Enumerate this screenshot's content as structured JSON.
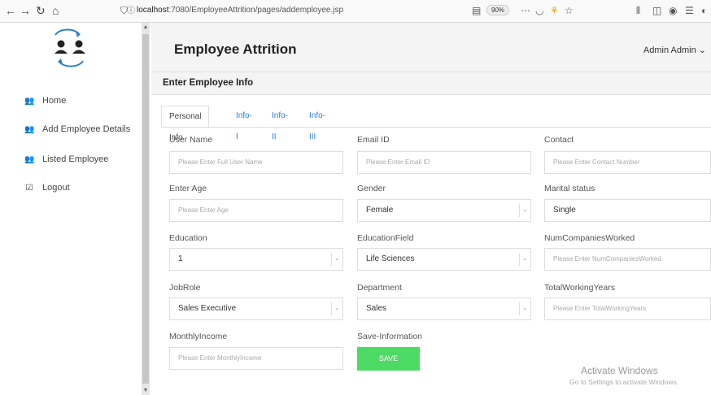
{
  "browser": {
    "back_icon": "back-arrow-icon",
    "forward_icon": "forward-arrow-icon",
    "reload_icon": "reload-icon",
    "home_icon": "home-icon",
    "url_host": "localhost",
    "url_rest": ":7080/EmployeeAttrition/pages/addemployee.jsp",
    "zoom": "90%"
  },
  "sidebar": {
    "items": [
      {
        "label": "Home",
        "icon": "users-icon"
      },
      {
        "label": "Add Employee Details",
        "icon": "users-icon"
      },
      {
        "label": "Listed Employee",
        "icon": "users-icon"
      },
      {
        "label": "Logout",
        "icon": "checkbox-icon"
      }
    ]
  },
  "header": {
    "title": "Employee Attrition",
    "user": "Admin Admin",
    "user_caret": "⌄"
  },
  "section": {
    "title": "Enter Employee Info"
  },
  "tabs": [
    "Personal Info",
    "Info-I",
    "Info-II",
    "Info-III"
  ],
  "form": {
    "user_name": {
      "label": "User Name",
      "placeholder": "Please Enter Full User Name"
    },
    "email": {
      "label": "Email ID",
      "placeholder": "Please Enter Email ID"
    },
    "contact": {
      "label": "Contact",
      "placeholder": "Please Enter Contact Number"
    },
    "age": {
      "label": "Enter Age",
      "placeholder": "Please Enter Age"
    },
    "gender": {
      "label": "Gender",
      "value": "Female"
    },
    "marital": {
      "label": "Marital status",
      "value": "Single"
    },
    "education": {
      "label": "Education",
      "value": "1"
    },
    "education_field": {
      "label": "EducationField",
      "value": "Life Sciences"
    },
    "num_companies": {
      "label": "NumCompaniesWorked",
      "placeholder": "Please Enter NumCompaniesWorked"
    },
    "job_role": {
      "label": "JobRole",
      "value": "Sales Executive"
    },
    "department": {
      "label": "Department",
      "value": "Sales"
    },
    "total_years": {
      "label": "TotalWorkingYears",
      "placeholder": "Please Enter TotalWorkingYears"
    },
    "monthly_income": {
      "label": "MonthlyIncome",
      "placeholder": "Please Enter MonthlyIncome"
    },
    "save_info": {
      "label": "Save-Information"
    },
    "save_button": "SAVE"
  },
  "watermark": {
    "line1": "Activate Windows",
    "line2": "Go to Settings to activate Windows."
  },
  "colors": {
    "save_green": "#4cd964",
    "tab_link": "#2a7fd4"
  }
}
